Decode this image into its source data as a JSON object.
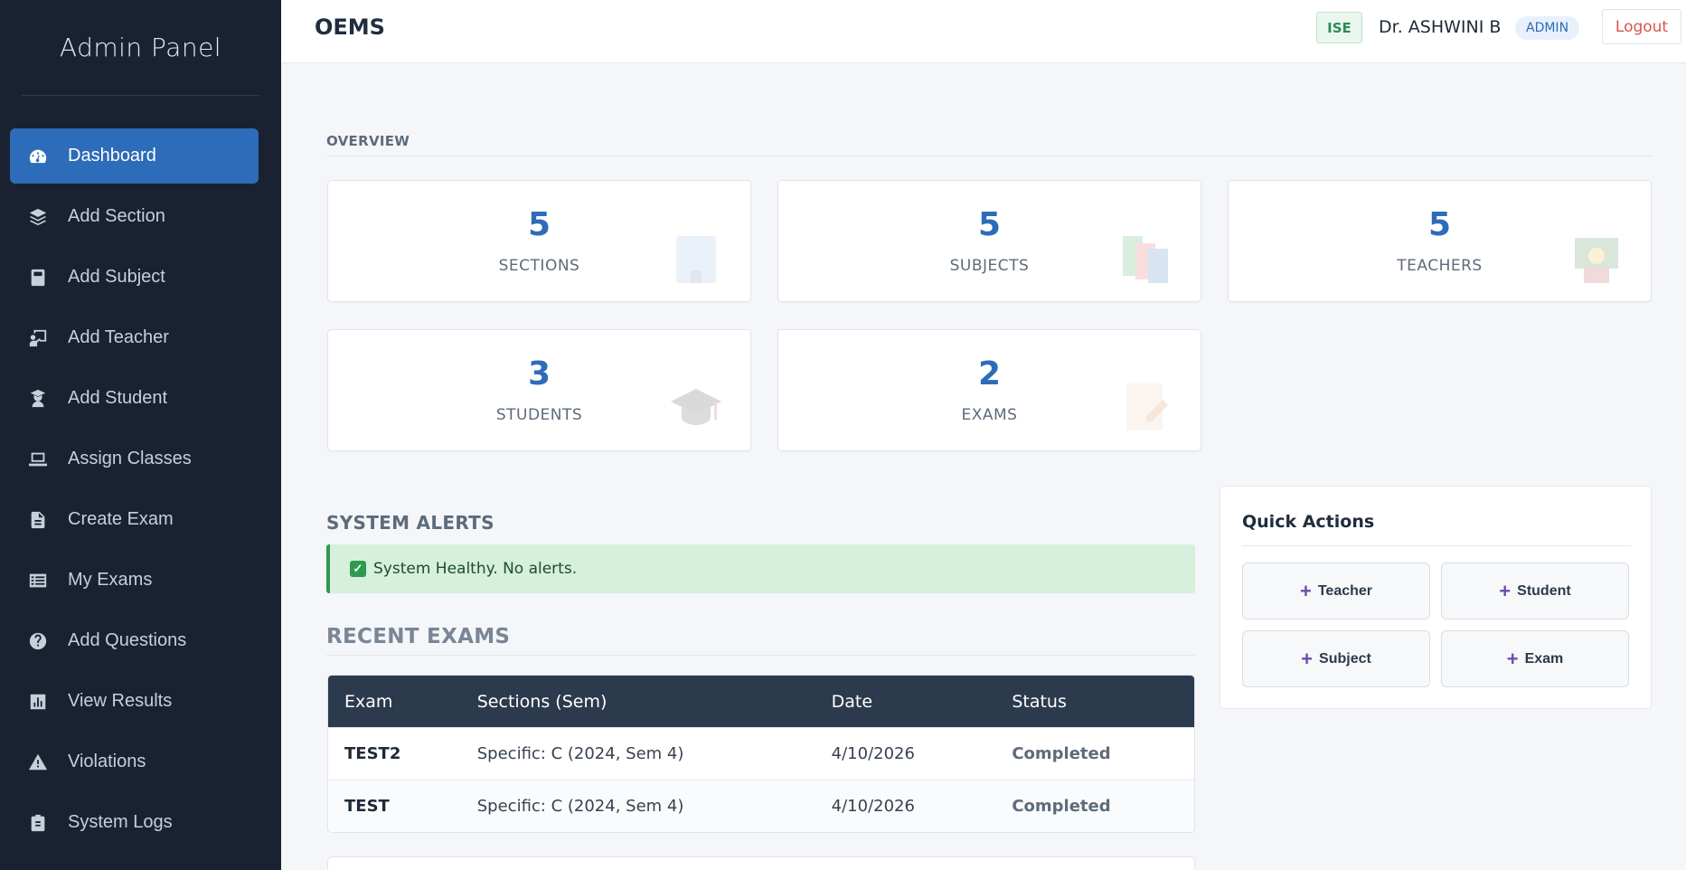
{
  "sidebar": {
    "title": "Admin Panel",
    "items": [
      {
        "label": "Dashboard",
        "icon": "gauge-icon",
        "active": true
      },
      {
        "label": "Add Section",
        "icon": "layers-icon"
      },
      {
        "label": "Add Subject",
        "icon": "book-icon"
      },
      {
        "label": "Add Teacher",
        "icon": "chalkboard-teacher-icon"
      },
      {
        "label": "Add Student",
        "icon": "user-graduate-icon"
      },
      {
        "label": "Assign Classes",
        "icon": "laptop-icon"
      },
      {
        "label": "Create Exam",
        "icon": "file-icon"
      },
      {
        "label": "My Exams",
        "icon": "list-icon"
      },
      {
        "label": "Add Questions",
        "icon": "question-circle-icon"
      },
      {
        "label": "View Results",
        "icon": "bar-chart-icon"
      },
      {
        "label": "Violations",
        "icon": "warning-icon"
      },
      {
        "label": "System Logs",
        "icon": "clipboard-icon"
      }
    ]
  },
  "header": {
    "brand": "OEMS",
    "department": "ISE",
    "user_name": "Dr. ASHWINI B",
    "role": "ADMIN",
    "logout_label": "Logout"
  },
  "overview": {
    "label": "OVERVIEW",
    "stats": [
      {
        "value": "5",
        "label": "SECTIONS",
        "icon": "building-icon"
      },
      {
        "value": "5",
        "label": "SUBJECTS",
        "icon": "books-icon"
      },
      {
        "value": "5",
        "label": "TEACHERS",
        "icon": "teacher-icon"
      },
      {
        "value": "3",
        "label": "STUDENTS",
        "icon": "graduation-cap-icon"
      },
      {
        "value": "2",
        "label": "EXAMS",
        "icon": "exam-paper-icon"
      }
    ]
  },
  "alerts": {
    "title": "SYSTEM ALERTS",
    "message": "System Healthy. No alerts."
  },
  "recent_exams": {
    "title": "RECENT EXAMS",
    "columns": [
      "Exam",
      "Sections (Sem)",
      "Date",
      "Status"
    ],
    "rows": [
      {
        "exam": "TEST2",
        "sections": "Specific: C (2024, Sem 4)",
        "date": "4/10/2026",
        "status": "Completed"
      },
      {
        "exam": "TEST",
        "sections": "Specific: C (2024, Sem 4)",
        "date": "4/10/2026",
        "status": "Completed"
      }
    ]
  },
  "quick_actions": {
    "title": "Quick Actions",
    "buttons": [
      {
        "label": "Teacher"
      },
      {
        "label": "Student"
      },
      {
        "label": "Subject"
      },
      {
        "label": "Exam"
      }
    ]
  },
  "colors": {
    "sidebar_bg": "#1a2232",
    "accent": "#2d6cb8",
    "table_header": "#2c3a4d",
    "alert_bg": "#d7efdd",
    "plus": "#6c4fa8",
    "logout": "#d9534f"
  }
}
